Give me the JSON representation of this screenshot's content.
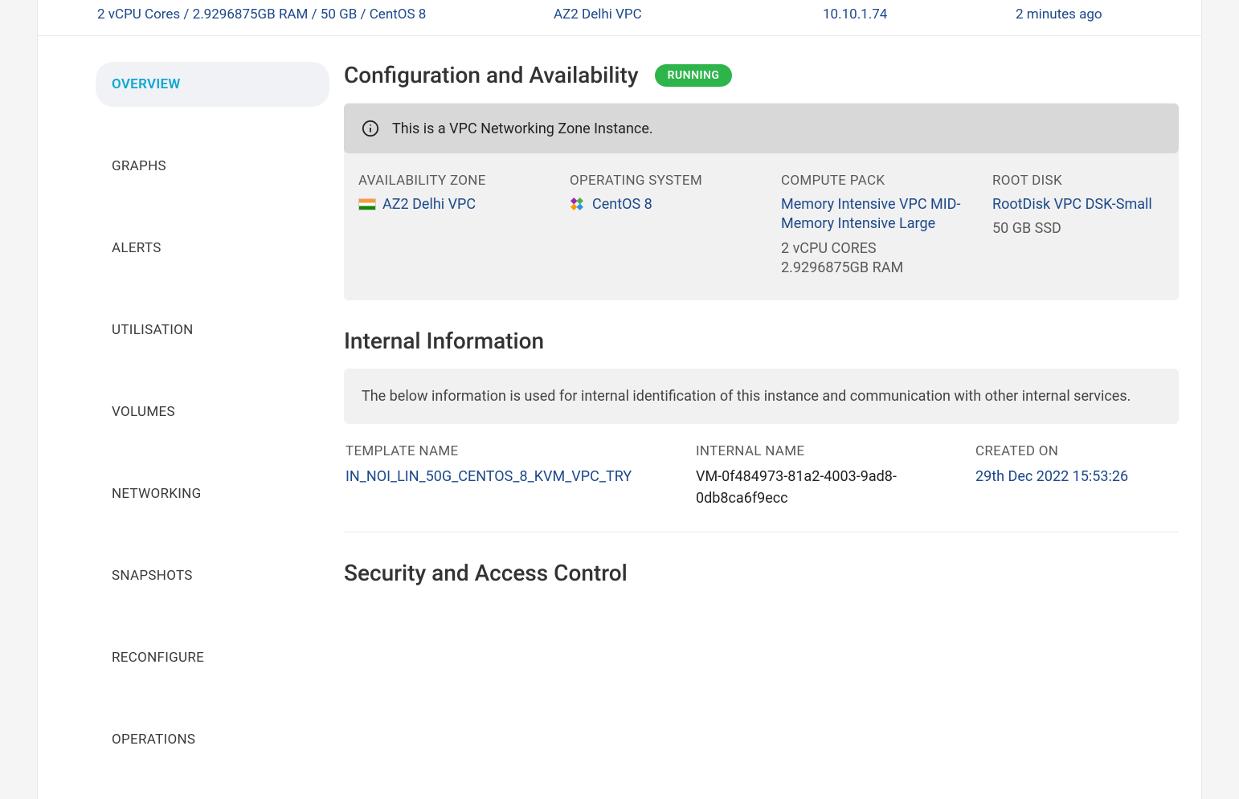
{
  "topRow": {
    "spec": "2 vCPU Cores / 2.9296875GB RAM / 50 GB / CentOS 8",
    "zone": "AZ2 Delhi VPC",
    "ip": "10.10.1.74",
    "age": "2 minutes ago"
  },
  "sidebar": {
    "items": [
      {
        "label": "OVERVIEW",
        "active": true
      },
      {
        "label": "GRAPHS",
        "active": false
      },
      {
        "label": "ALERTS",
        "active": false
      },
      {
        "label": "UTILISATION",
        "active": false
      },
      {
        "label": "VOLUMES",
        "active": false
      },
      {
        "label": "NETWORKING",
        "active": false
      },
      {
        "label": "SNAPSHOTS",
        "active": false
      },
      {
        "label": "RECONFIGURE",
        "active": false
      },
      {
        "label": "OPERATIONS",
        "active": false
      }
    ]
  },
  "config": {
    "title": "Configuration and Availability",
    "status": "RUNNING",
    "notice": "This is a VPC Networking Zone Instance.",
    "azLabel": "AVAILABILITY ZONE",
    "azValue": "AZ2 Delhi VPC",
    "osLabel": "OPERATING SYSTEM",
    "osValue": "CentOS 8",
    "cpLabel": "COMPUTE PACK",
    "cpValue": "Memory Intensive VPC MID-Memory Intensive Large",
    "cpCores": "2 vCPU CORES",
    "cpRam": "2.9296875GB RAM",
    "rdLabel": "ROOT DISK",
    "rdValue": "RootDisk VPC DSK-Small",
    "rdSize": "50 GB SSD"
  },
  "internal": {
    "title": "Internal Information",
    "banner": "The below information is used for internal identification of this instance and communication with other internal services.",
    "templateLabel": "TEMPLATE NAME",
    "templateValue": "IN_NOI_LIN_50G_CENTOS_8_KVM_VPC_TRY",
    "internalNameLabel": "INTERNAL NAME",
    "internalNameValue": "VM-0f484973-81a2-4003-9ad8-0db8ca6f9ecc",
    "createdLabel": "CREATED ON",
    "createdValue": "29th Dec 2022 15:53:26"
  },
  "security": {
    "title": "Security and Access Control"
  }
}
